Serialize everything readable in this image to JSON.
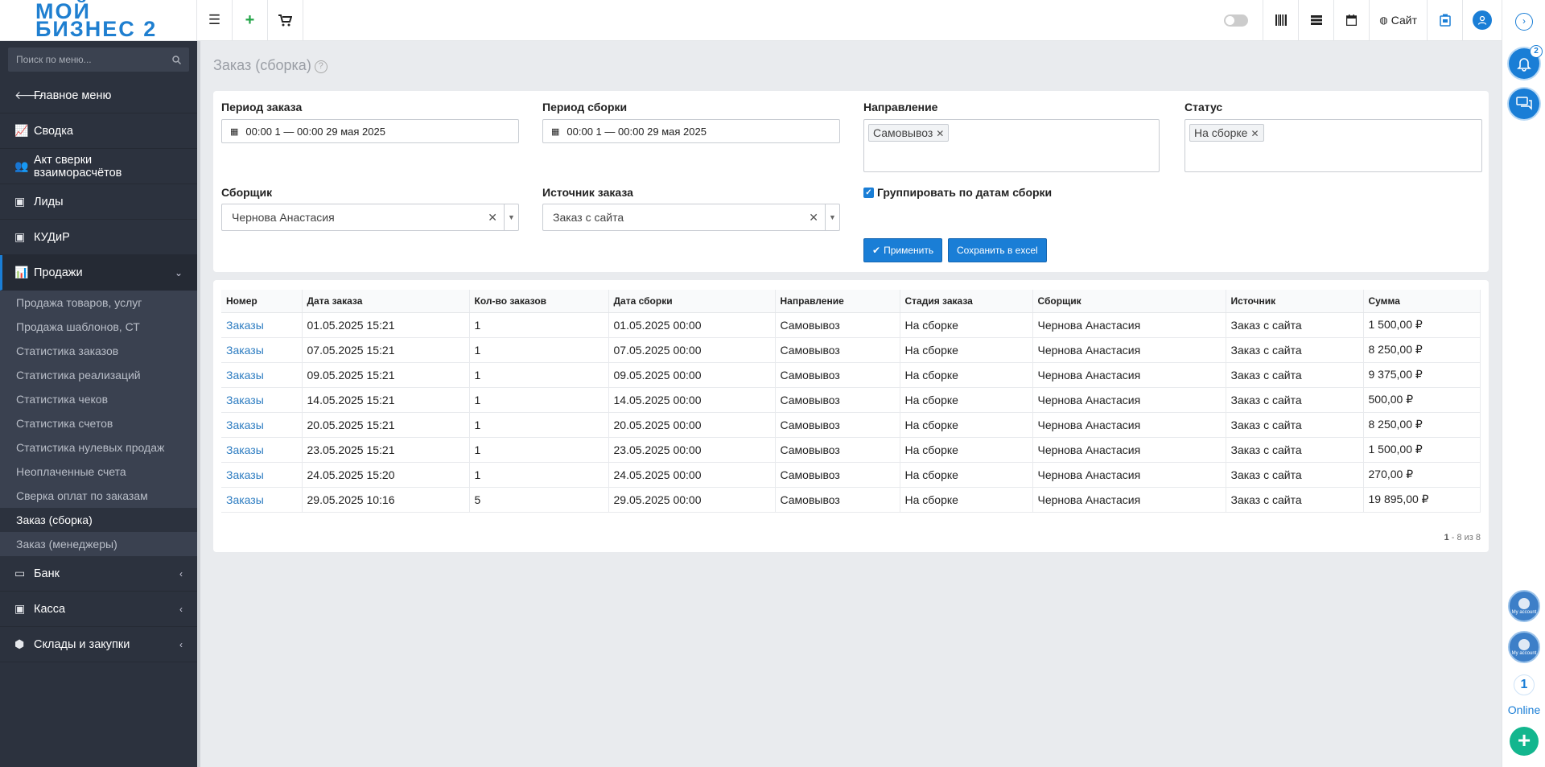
{
  "logo": {
    "line1": "МОЙ",
    "line2": "БИЗНЕС 2"
  },
  "topbar": {
    "menu_icon": "☰",
    "plus_icon": "+",
    "cart_icon": "🛒",
    "site_label": "Сайт"
  },
  "sidebar": {
    "search_placeholder": "Поиск по меню...",
    "items": [
      {
        "label": "Главное меню",
        "icon": "arrow-left-icon"
      },
      {
        "label": "Сводка",
        "icon": "chart-line-icon"
      },
      {
        "label": "Акт сверки взаиморасчётов",
        "icon": "users-icon"
      },
      {
        "label": "Лиды",
        "icon": "contact-card-icon"
      },
      {
        "label": "КУДиР",
        "icon": "contact-card-icon"
      },
      {
        "label": "Продажи",
        "icon": "bar-chart-icon"
      }
    ],
    "sub_items": [
      "Продажа товаров, услуг",
      "Продажа шаблонов, СТ",
      "Статистика заказов",
      "Статистика реализаций",
      "Статистика чеков",
      "Статистика счетов",
      "Статистика нулевых продаж",
      "Неоплаченные счета",
      "Сверка оплат по заказам",
      "Заказ (сборка)",
      "Заказ (менеджеры)"
    ],
    "items_bottom": [
      {
        "label": "Банк",
        "icon": "credit-card-icon"
      },
      {
        "label": "Касса",
        "icon": "money-icon"
      },
      {
        "label": "Склады и закупки",
        "icon": "box-icon"
      }
    ]
  },
  "page": {
    "title": "Заказ (сборка)"
  },
  "filters": {
    "order_period_label": "Период заказа",
    "order_period_value": "00:00 1 — 00:00 29 мая 2025",
    "assembly_period_label": "Период сборки",
    "assembly_period_value": "00:00 1 — 00:00 29 мая 2025",
    "direction_label": "Направление",
    "direction_tag": "Самовывоз",
    "status_label": "Статус",
    "status_tag": "На сборке",
    "assembler_label": "Сборщик",
    "assembler_value": "Чернова Анастасия",
    "source_label": "Источник заказа",
    "source_value": "Заказ с сайта",
    "group_checkbox_label": "Группировать по датам сборки",
    "apply_label": "Применить",
    "excel_label": "Сохранить в excel"
  },
  "table": {
    "headers": [
      "Номер",
      "Дата заказа",
      "Кол-во заказов",
      "Дата сборки",
      "Направление",
      "Стадия заказа",
      "Сборщик",
      "Источник",
      "Сумма"
    ],
    "rows": [
      [
        "Заказы",
        "01.05.2025 15:21",
        "1",
        "01.05.2025 00:00",
        "Самовывоз",
        "На сборке",
        "Чернова Анастасия",
        "Заказ с сайта",
        "1 500,00 ₽"
      ],
      [
        "Заказы",
        "07.05.2025 15:21",
        "1",
        "07.05.2025 00:00",
        "Самовывоз",
        "На сборке",
        "Чернова Анастасия",
        "Заказ с сайта",
        "8 250,00 ₽"
      ],
      [
        "Заказы",
        "09.05.2025 15:21",
        "1",
        "09.05.2025 00:00",
        "Самовывоз",
        "На сборке",
        "Чернова Анастасия",
        "Заказ с сайта",
        "9 375,00 ₽"
      ],
      [
        "Заказы",
        "14.05.2025 15:21",
        "1",
        "14.05.2025 00:00",
        "Самовывоз",
        "На сборке",
        "Чернова Анастасия",
        "Заказ с сайта",
        "500,00 ₽"
      ],
      [
        "Заказы",
        "20.05.2025 15:21",
        "1",
        "20.05.2025 00:00",
        "Самовывоз",
        "На сборке",
        "Чернова Анастасия",
        "Заказ с сайта",
        "8 250,00 ₽"
      ],
      [
        "Заказы",
        "23.05.2025 15:21",
        "1",
        "23.05.2025 00:00",
        "Самовывоз",
        "На сборке",
        "Чернова Анастасия",
        "Заказ с сайта",
        "1 500,00 ₽"
      ],
      [
        "Заказы",
        "24.05.2025 15:20",
        "1",
        "24.05.2025 00:00",
        "Самовывоз",
        "На сборке",
        "Чернова Анастасия",
        "Заказ с сайта",
        "270,00 ₽"
      ],
      [
        "Заказы",
        "29.05.2025 10:16",
        "5",
        "29.05.2025 00:00",
        "Самовывоз",
        "На сборке",
        "Чернова Анастасия",
        "Заказ с сайта",
        "19 895,00 ₽"
      ]
    ],
    "pager_range": "1",
    "pager_rest": " - 8 из 8"
  },
  "rail": {
    "notify_count": "2",
    "account_label": "My account",
    "online_count": "1",
    "online_label": "Online"
  },
  "colors": {
    "accent": "#1a7ed6",
    "sidebar": "#2c323e",
    "success": "#13b68e"
  }
}
